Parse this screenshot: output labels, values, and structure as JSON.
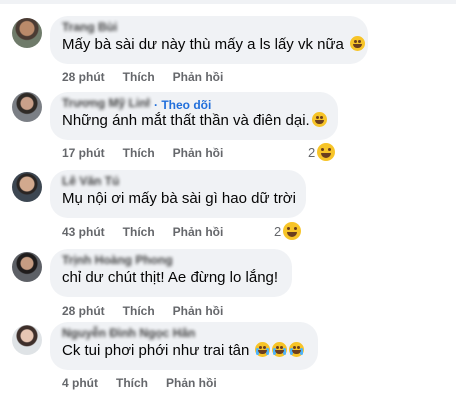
{
  "colors": {
    "bubble": "#f0f2f5",
    "action_text": "#65676b",
    "follow": "#216fdb",
    "emoji": "#f7c428"
  },
  "actions": {
    "like": "Thích",
    "reply": "Phản hồi"
  },
  "comments": [
    {
      "author": "Trang Bùi",
      "text": "Mấy bà sài dư này thù mấy a ls lấy vk nữa",
      "emoji": [
        "laughing-tears"
      ],
      "time": "28 phút"
    },
    {
      "author": "Trương Mỹ Linh",
      "follow": "· Theo dõi",
      "text": "Những ánh mắt thất thần và điên dại.",
      "emoji": [
        "laughing-tears"
      ],
      "time": "17 phút",
      "reaction_count": "2"
    },
    {
      "author": "Lê Văn Tú",
      "text": "Mụ nội ơi mấy bà sài gì hao dữ trời",
      "emoji": [],
      "time": "43 phút",
      "reaction_count": "2"
    },
    {
      "author": "Trịnh Hoàng Phong",
      "text": "chỉ dư chút thịt! Ae đừng lo lắng!",
      "emoji": [],
      "time": "28 phút"
    },
    {
      "author": "Nguyễn Đình Ngọc Hân",
      "text": "Ck tui phơi phới như trai tân",
      "emoji": [
        "crying",
        "crying",
        "crying"
      ],
      "time": "4 phút"
    }
  ]
}
